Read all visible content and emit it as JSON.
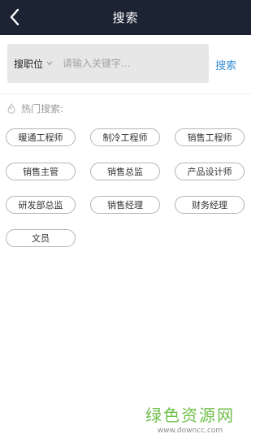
{
  "header": {
    "title": "搜索"
  },
  "search": {
    "scope_label": "搜职位",
    "placeholder": "请输入关键字...",
    "button_label": "搜索"
  },
  "hot": {
    "title": "热门搜索:",
    "tags": [
      "暖通工程师",
      "制冷工程师",
      "销售工程师",
      "销售主管",
      "销售总监",
      "产品设计师",
      "研发部总监",
      "销售经理",
      "财务经理",
      "文员"
    ]
  },
  "watermark": {
    "text": "绿色资源网",
    "url": "www.downcc.com"
  },
  "colors": {
    "header_bg": "#1c2333",
    "accent": "#3a8fd6",
    "watermark": "#6fbf4a"
  },
  "icons": {
    "back": "chevron-left-icon",
    "caret": "chevron-down-icon",
    "hot": "flame-icon"
  }
}
